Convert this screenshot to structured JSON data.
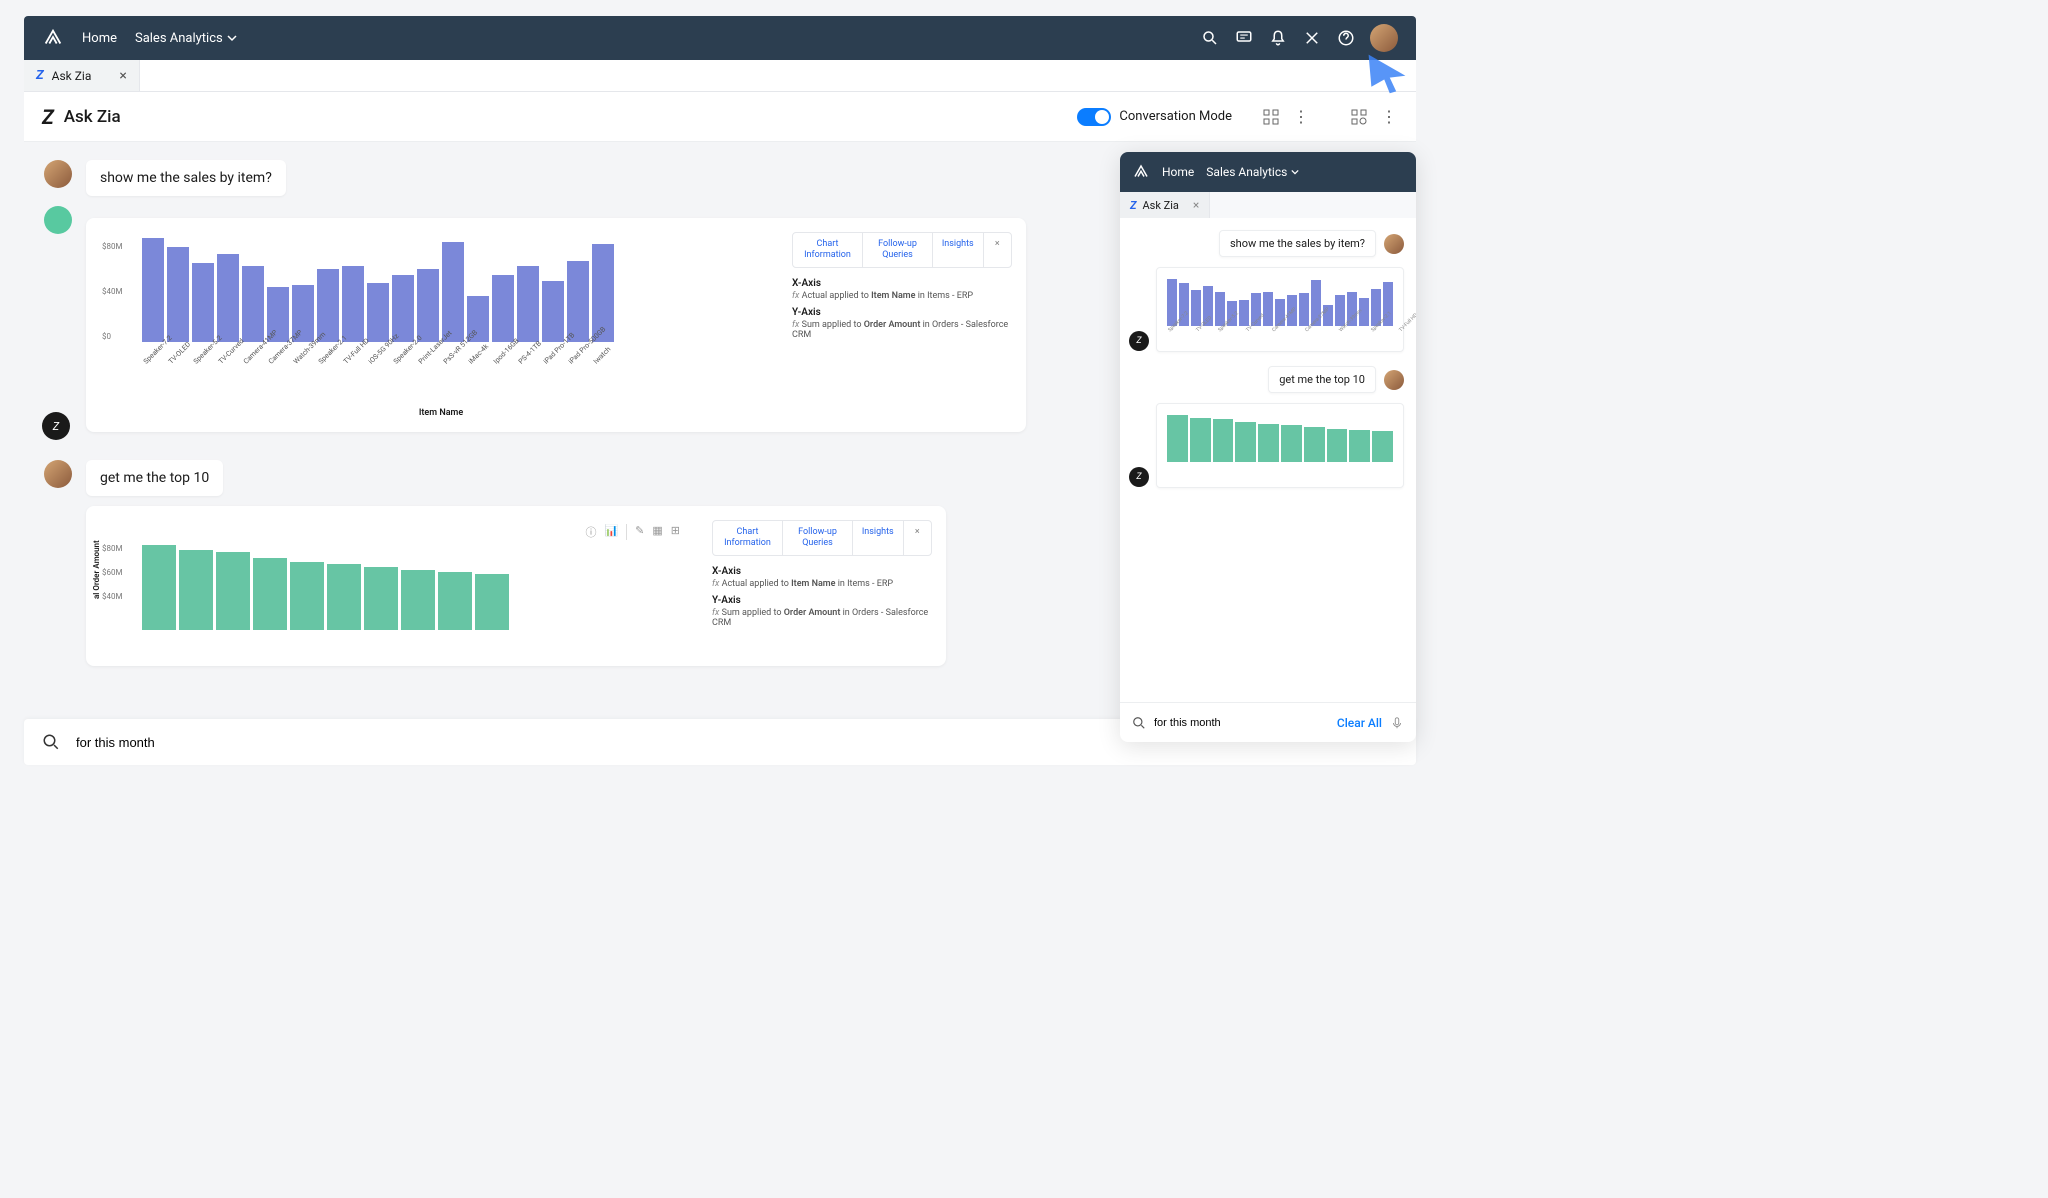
{
  "nav": {
    "home": "Home",
    "sales": "Sales Analytics"
  },
  "tab": {
    "title": "Ask Zia"
  },
  "header": {
    "title": "Ask Zia",
    "mode": "Conversation Mode"
  },
  "messages": {
    "q1": "show me the sales by item?",
    "q2": "get me the top 10"
  },
  "side_tabs": {
    "info": "Chart\nInformation",
    "follow": "Follow-up\nQueries",
    "insights": "Insights"
  },
  "axes": {
    "x_label": "X-Axis",
    "x_desc_pre": "Actual applied to ",
    "x_field": "Item Name",
    "x_desc_post": " in Items - ERP",
    "y_label": "Y-Axis",
    "y_desc_pre": "Sum applied to ",
    "y_field": "Order Amount",
    "y_desc_post": " in Orders - Salesforce CRM"
  },
  "chart_data": [
    {
      "type": "bar",
      "title": "",
      "xlabel": "Item Name",
      "ylabel": "",
      "ylim": [
        0,
        90
      ],
      "yticks": [
        "$80M",
        "$40M",
        "$0"
      ],
      "categories": [
        "Speaker-7.2",
        "TV-OLED",
        "Speaker-5.2",
        "TV-Curved",
        "Camera-41MP",
        "Camera-37MP",
        "Watch-39mm",
        "Speaker-2.1",
        "TV-Full HD",
        "iOS-5G 90Hz",
        "Speaker-2.0",
        "Print-LaserJet",
        "PsS-vR 512GB",
        "iMac-4k",
        "Ipod-16GB",
        "PS-4-1TB",
        "iPad Pro-1TB",
        "iPad Pro-500GB",
        "Iwatch"
      ],
      "values": [
        85,
        78,
        65,
        72,
        62,
        45,
        47,
        60,
        62,
        48,
        55,
        60,
        82,
        38,
        55,
        62,
        50,
        66,
        80
      ],
      "color": "#7b88d9"
    },
    {
      "type": "bar",
      "title": "",
      "xlabel": "",
      "ylabel": "al Order Amount",
      "ylim": [
        0,
        90
      ],
      "yticks": [
        "$80M",
        "$60M",
        "$40M"
      ],
      "categories": [
        "",
        "",
        "",
        "",
        "",
        "",
        "",
        "",
        "",
        ""
      ],
      "values": [
        85,
        80,
        78,
        72,
        68,
        66,
        63,
        60,
        58,
        56
      ],
      "color": "#67c5a4"
    }
  ],
  "search": {
    "value": "for this month"
  },
  "mini": {
    "nav": {
      "home": "Home",
      "sales": "Sales Analytics"
    },
    "tab": "Ask Zia",
    "q1": "show me the sales by item?",
    "q2": "get me the top 10",
    "search_value": "for this month",
    "clear": "Clear All"
  }
}
